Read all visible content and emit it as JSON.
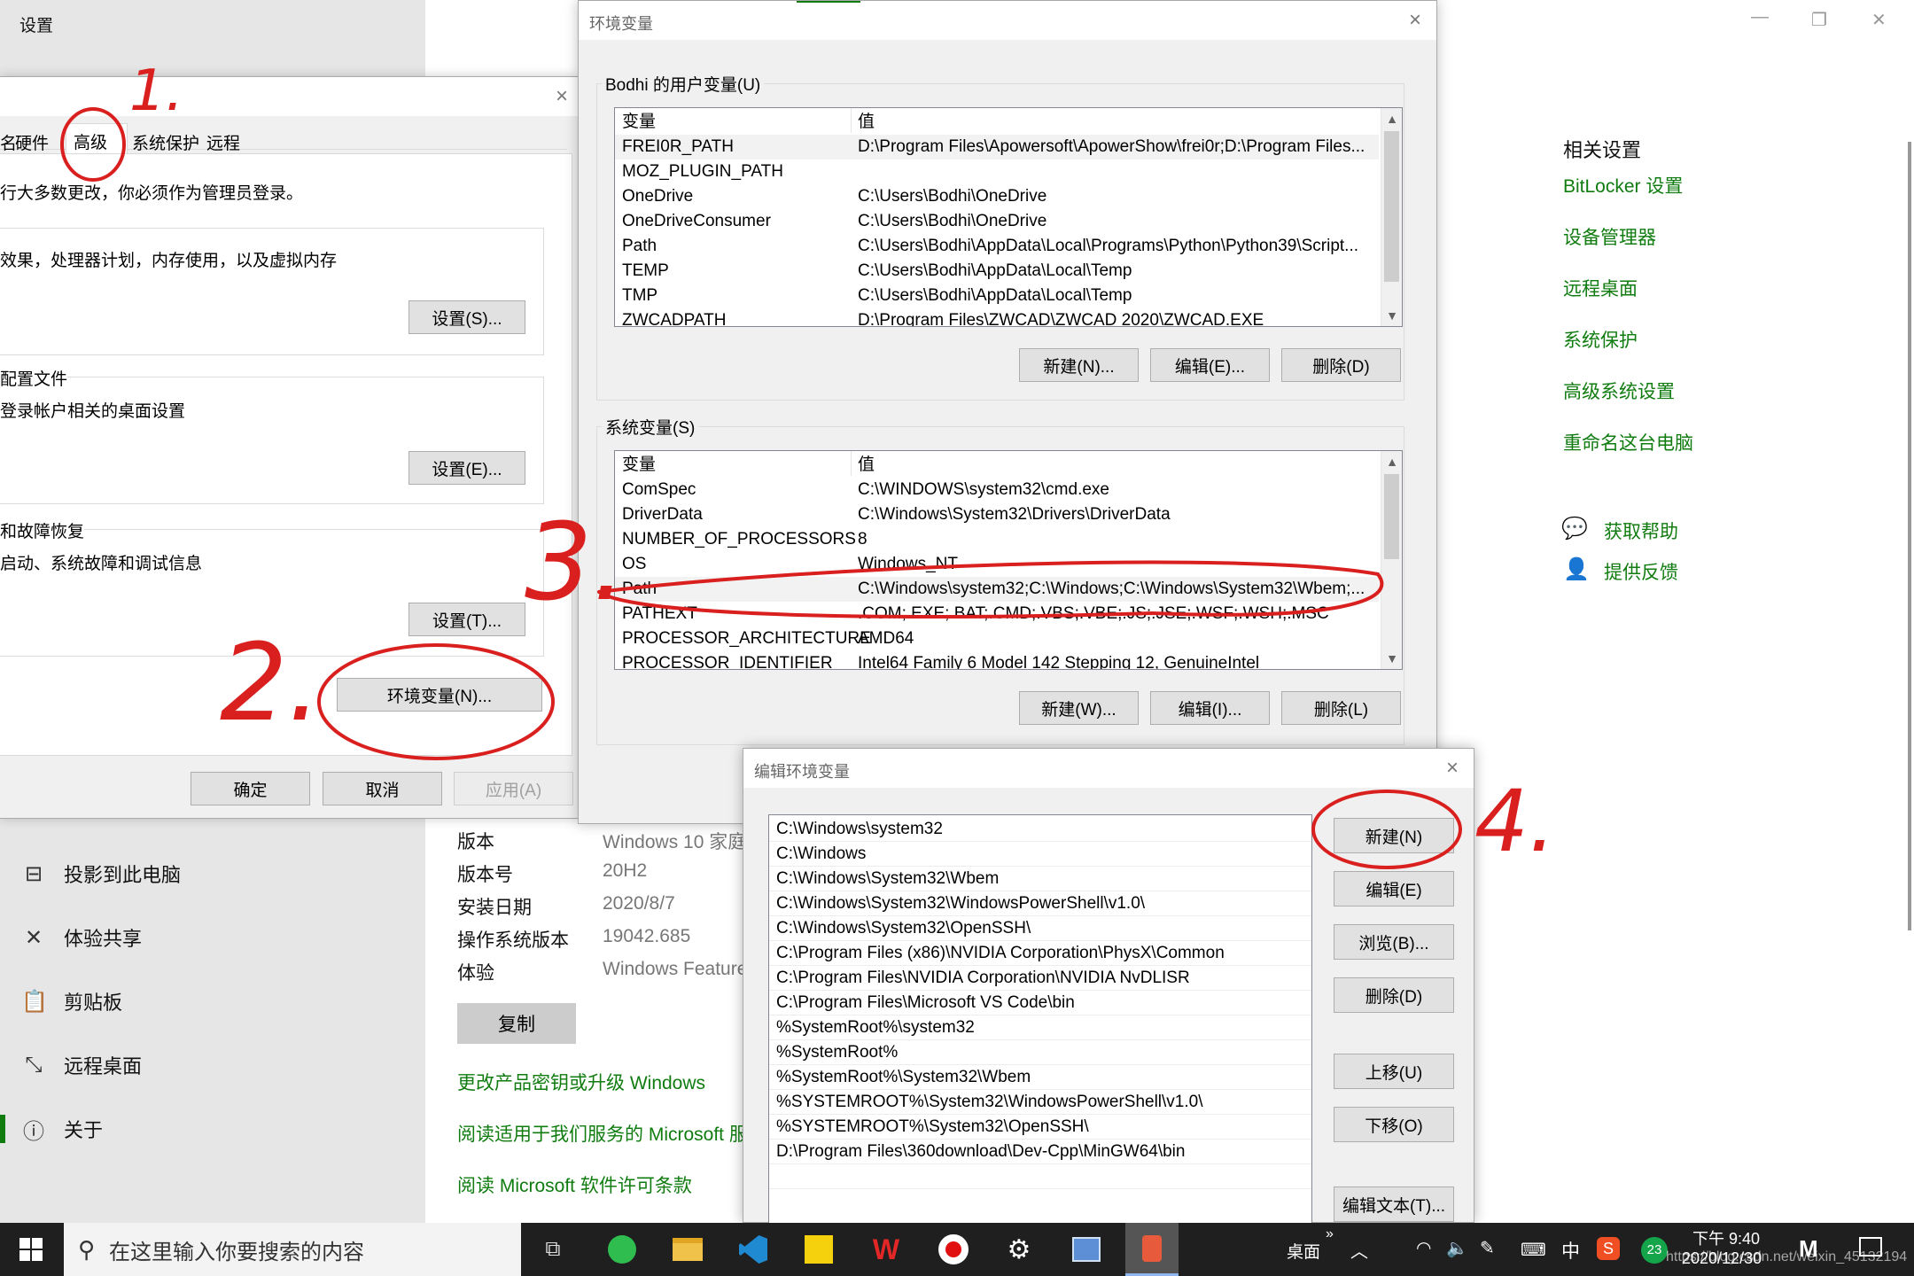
{
  "settings_window": {
    "title": "设置",
    "window_controls": {
      "minimize": "—",
      "restore": "❐",
      "close": "✕"
    },
    "nav": [
      {
        "label": "投影到此电脑",
        "icon": "projector-icon"
      },
      {
        "label": "体验共享",
        "icon": "share-icon"
      },
      {
        "label": "剪贴板",
        "icon": "clipboard-icon"
      },
      {
        "label": "远程桌面",
        "icon": "remote-desktop-icon"
      },
      {
        "label": "关于",
        "icon": "info-icon"
      }
    ],
    "windows_spec": [
      {
        "key": "版本",
        "value": "Windows 10 家庭"
      },
      {
        "key": "版本号",
        "value": "20H2"
      },
      {
        "key": "安装日期",
        "value": "2020/8/7"
      },
      {
        "key": "操作系统版本",
        "value": "19042.685"
      },
      {
        "key": "体验",
        "value": "Windows Feature"
      }
    ],
    "copy_button": "复制",
    "links": [
      "更改产品密钥或升级 Windows",
      "阅读适用于我们服务的 Microsoft 服",
      "阅读 Microsoft 软件许可条款"
    ],
    "related_settings": {
      "heading": "相关设置",
      "items": [
        "BitLocker 设置",
        "设备管理器",
        "远程桌面",
        "系统保护",
        "高级系统设置",
        "重命名这台电脑"
      ]
    },
    "help": {
      "get_help": "获取帮助",
      "feedback": "提供反馈"
    }
  },
  "system_properties": {
    "tabs": [
      "名",
      "硬件",
      "高级",
      "系统保护",
      "远程"
    ],
    "selected_tab": "高级",
    "admin_note": "行大多数更改，你必须作为管理员登录。",
    "performance": {
      "desc": "效果，处理器计划，内存使用，以及虚拟内存",
      "button": "设置(S)..."
    },
    "user_profiles": {
      "label": "配置文件",
      "desc": "登录帐户相关的桌面设置",
      "button": "设置(E)..."
    },
    "startup_recovery": {
      "label": "和故障恢复",
      "desc": "启动、系统故障和调试信息",
      "button": "设置(T)..."
    },
    "env_button": "环境变量(N)...",
    "ok": "确定",
    "cancel": "取消",
    "apply": "应用(A)"
  },
  "env_vars_dialog": {
    "title": "环境变量",
    "user_group_label": "Bodhi 的用户变量(U)",
    "col_var": "变量",
    "col_val": "值",
    "user_vars": [
      {
        "name": "FREI0R_PATH",
        "value": "D:\\Program Files\\Apowersoft\\ApowerShow\\frei0r;D:\\Program Files..."
      },
      {
        "name": "MOZ_PLUGIN_PATH",
        "value": ""
      },
      {
        "name": "OneDrive",
        "value": "C:\\Users\\Bodhi\\OneDrive"
      },
      {
        "name": "OneDriveConsumer",
        "value": "C:\\Users\\Bodhi\\OneDrive"
      },
      {
        "name": "Path",
        "value": "C:\\Users\\Bodhi\\AppData\\Local\\Programs\\Python\\Python39\\Script..."
      },
      {
        "name": "TEMP",
        "value": "C:\\Users\\Bodhi\\AppData\\Local\\Temp"
      },
      {
        "name": "TMP",
        "value": "C:\\Users\\Bodhi\\AppData\\Local\\Temp"
      },
      {
        "name": "ZWCADPATH",
        "value": "D:\\Program Files\\ZWCAD\\ZWCAD 2020\\ZWCAD.EXE"
      }
    ],
    "user_buttons": {
      "new": "新建(N)...",
      "edit": "编辑(E)...",
      "delete": "删除(D)"
    },
    "system_group_label": "系统变量(S)",
    "system_vars": [
      {
        "name": "ComSpec",
        "value": "C:\\WINDOWS\\system32\\cmd.exe"
      },
      {
        "name": "DriverData",
        "value": "C:\\Windows\\System32\\Drivers\\DriverData"
      },
      {
        "name": "NUMBER_OF_PROCESSORS",
        "value": "8"
      },
      {
        "name": "OS",
        "value": "Windows_NT"
      },
      {
        "name": "Path",
        "value": "C:\\Windows\\system32;C:\\Windows;C:\\Windows\\System32\\Wbem;..."
      },
      {
        "name": "PATHEXT",
        "value": ".COM;.EXE;.BAT;.CMD;.VBS;.VBE;.JS;.JSE;.WSF;.WSH;.MSC"
      },
      {
        "name": "PROCESSOR_ARCHITECTURE",
        "value": "AMD64"
      },
      {
        "name": "PROCESSOR_IDENTIFIER",
        "value": "Intel64 Family 6 Model 142 Stepping 12, GenuineIntel"
      }
    ],
    "system_buttons": {
      "new": "新建(W)...",
      "edit": "编辑(I)...",
      "delete": "删除(L)"
    }
  },
  "edit_env_dialog": {
    "title": "编辑环境变量",
    "entries": [
      "C:\\Windows\\system32",
      "C:\\Windows",
      "C:\\Windows\\System32\\Wbem",
      "C:\\Windows\\System32\\WindowsPowerShell\\v1.0\\",
      "C:\\Windows\\System32\\OpenSSH\\",
      "C:\\Program Files (x86)\\NVIDIA Corporation\\PhysX\\Common",
      "C:\\Program Files\\NVIDIA Corporation\\NVIDIA NvDLISR",
      "C:\\Program Files\\Microsoft VS Code\\bin",
      "%SystemRoot%\\system32",
      "%SystemRoot%",
      "%SystemRoot%\\System32\\Wbem",
      "%SYSTEMROOT%\\System32\\WindowsPowerShell\\v1.0\\",
      "%SYSTEMROOT%\\System32\\OpenSSH\\",
      "D:\\Program Files\\360download\\Dev-Cpp\\MinGW64\\bin"
    ],
    "buttons": {
      "new": "新建(N)",
      "edit": "编辑(E)",
      "browse": "浏览(B)...",
      "delete": "删除(D)",
      "up": "上移(U)",
      "down": "下移(O)",
      "edit_text": "编辑文本(T)..."
    }
  },
  "taskbar": {
    "search_placeholder": "在这里输入你要搜索的内容",
    "desktop_label": "桌面",
    "ime": "中",
    "notification_count": "23",
    "time": "下午 9:40",
    "date": "2020/12/30",
    "watermark": "https://blog.csdn.net/weixin_45132194",
    "apps": [
      "task-view-icon",
      "edge-icon",
      "file-explorer-icon",
      "vscode-icon",
      "media-player-icon",
      "wps-icon",
      "record-icon",
      "settings-icon",
      "control-panel-icon",
      "paint-icon"
    ]
  },
  "annotations": [
    "1.",
    "2.",
    "3.",
    "4."
  ],
  "colors": {
    "accent_green": "#107c10",
    "annotation_red": "#d9201f",
    "taskbar_bg": "#1f1f1f"
  }
}
